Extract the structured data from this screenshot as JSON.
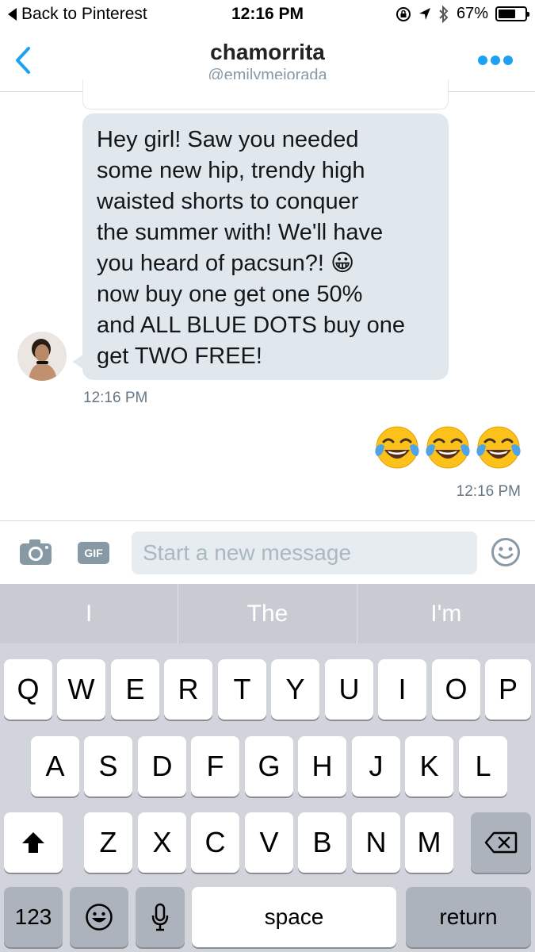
{
  "status_bar": {
    "back_label": "Back to Pinterest",
    "time": "12:16 PM",
    "battery": "67%",
    "battery_level": 0.67
  },
  "header": {
    "name": "chamorrita",
    "handle": "@emilymejorada"
  },
  "conversation": {
    "incoming": {
      "text": "Hey girl! Saw you needed\nsome new hip, trendy high\nwaisted shorts to conquer\nthe summer with! We'll have\nyou heard of pacsun?! 😀\nnow buy one get one 50%\nand ALL BLUE DOTS buy one\nget TWO FREE!",
      "time": "12:16 PM"
    },
    "outgoing": {
      "emoji": "😂😂😂",
      "time": "12:16 PM"
    }
  },
  "composer": {
    "placeholder": "Start a new message",
    "gif_label": "GIF"
  },
  "keyboard": {
    "suggestions": [
      "I",
      "The",
      "I'm"
    ],
    "row1": [
      "Q",
      "W",
      "E",
      "R",
      "T",
      "Y",
      "U",
      "I",
      "O",
      "P"
    ],
    "row2": [
      "A",
      "S",
      "D",
      "F",
      "G",
      "H",
      "J",
      "K",
      "L"
    ],
    "row3": [
      "Z",
      "X",
      "C",
      "V",
      "B",
      "N",
      "M"
    ],
    "numbers_label": "123",
    "space_label": "space",
    "return_label": "return"
  },
  "colors": {
    "accent": "#1da1f2",
    "bubble": "#e1e8ed",
    "keyboard_bg": "#d1d5db"
  }
}
